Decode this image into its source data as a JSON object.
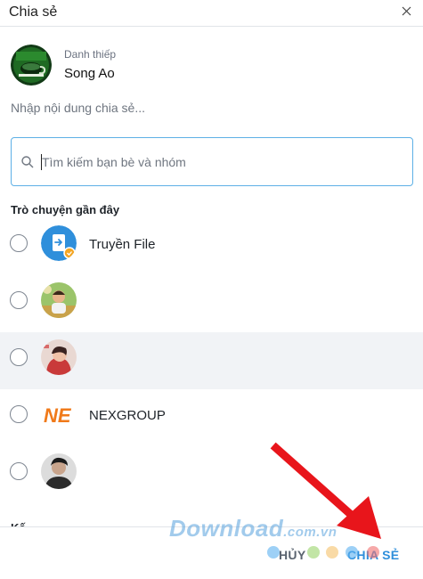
{
  "window": {
    "title": "Chia sẻ"
  },
  "card": {
    "kind": "Danh thiếp",
    "name": "Song Ao"
  },
  "message": {
    "placeholder": "Nhập nội dung chia sẻ..."
  },
  "search": {
    "placeholder": "Tìm kiếm bạn bè và nhóm"
  },
  "recent": {
    "heading": "Trò chuyện gần đây",
    "contacts": [
      {
        "name": "Truyền File",
        "avatar": "transfer-file-icon",
        "selected": false
      },
      {
        "name": "",
        "avatar": "user-photo",
        "selected": false
      },
      {
        "name": "",
        "avatar": "user-photo",
        "selected": false
      },
      {
        "name": "NEXGROUP",
        "avatar": "nexgroup-logo",
        "selected": false
      },
      {
        "name": "",
        "avatar": "user-photo",
        "selected": false
      }
    ]
  },
  "next_heading": "Kế",
  "footer": {
    "cancel_label": "HỦY",
    "share_label": "CHIA SẺ"
  },
  "logos": {
    "nexgroup_mark": "NE"
  },
  "watermark": {
    "text": "Download",
    "tld": ".com.vn"
  },
  "colors": {
    "accent": "#2f8fdb",
    "search_border": "#5db0e6",
    "arrow": "#e8151b",
    "row_highlight": "#f1f3f6"
  }
}
